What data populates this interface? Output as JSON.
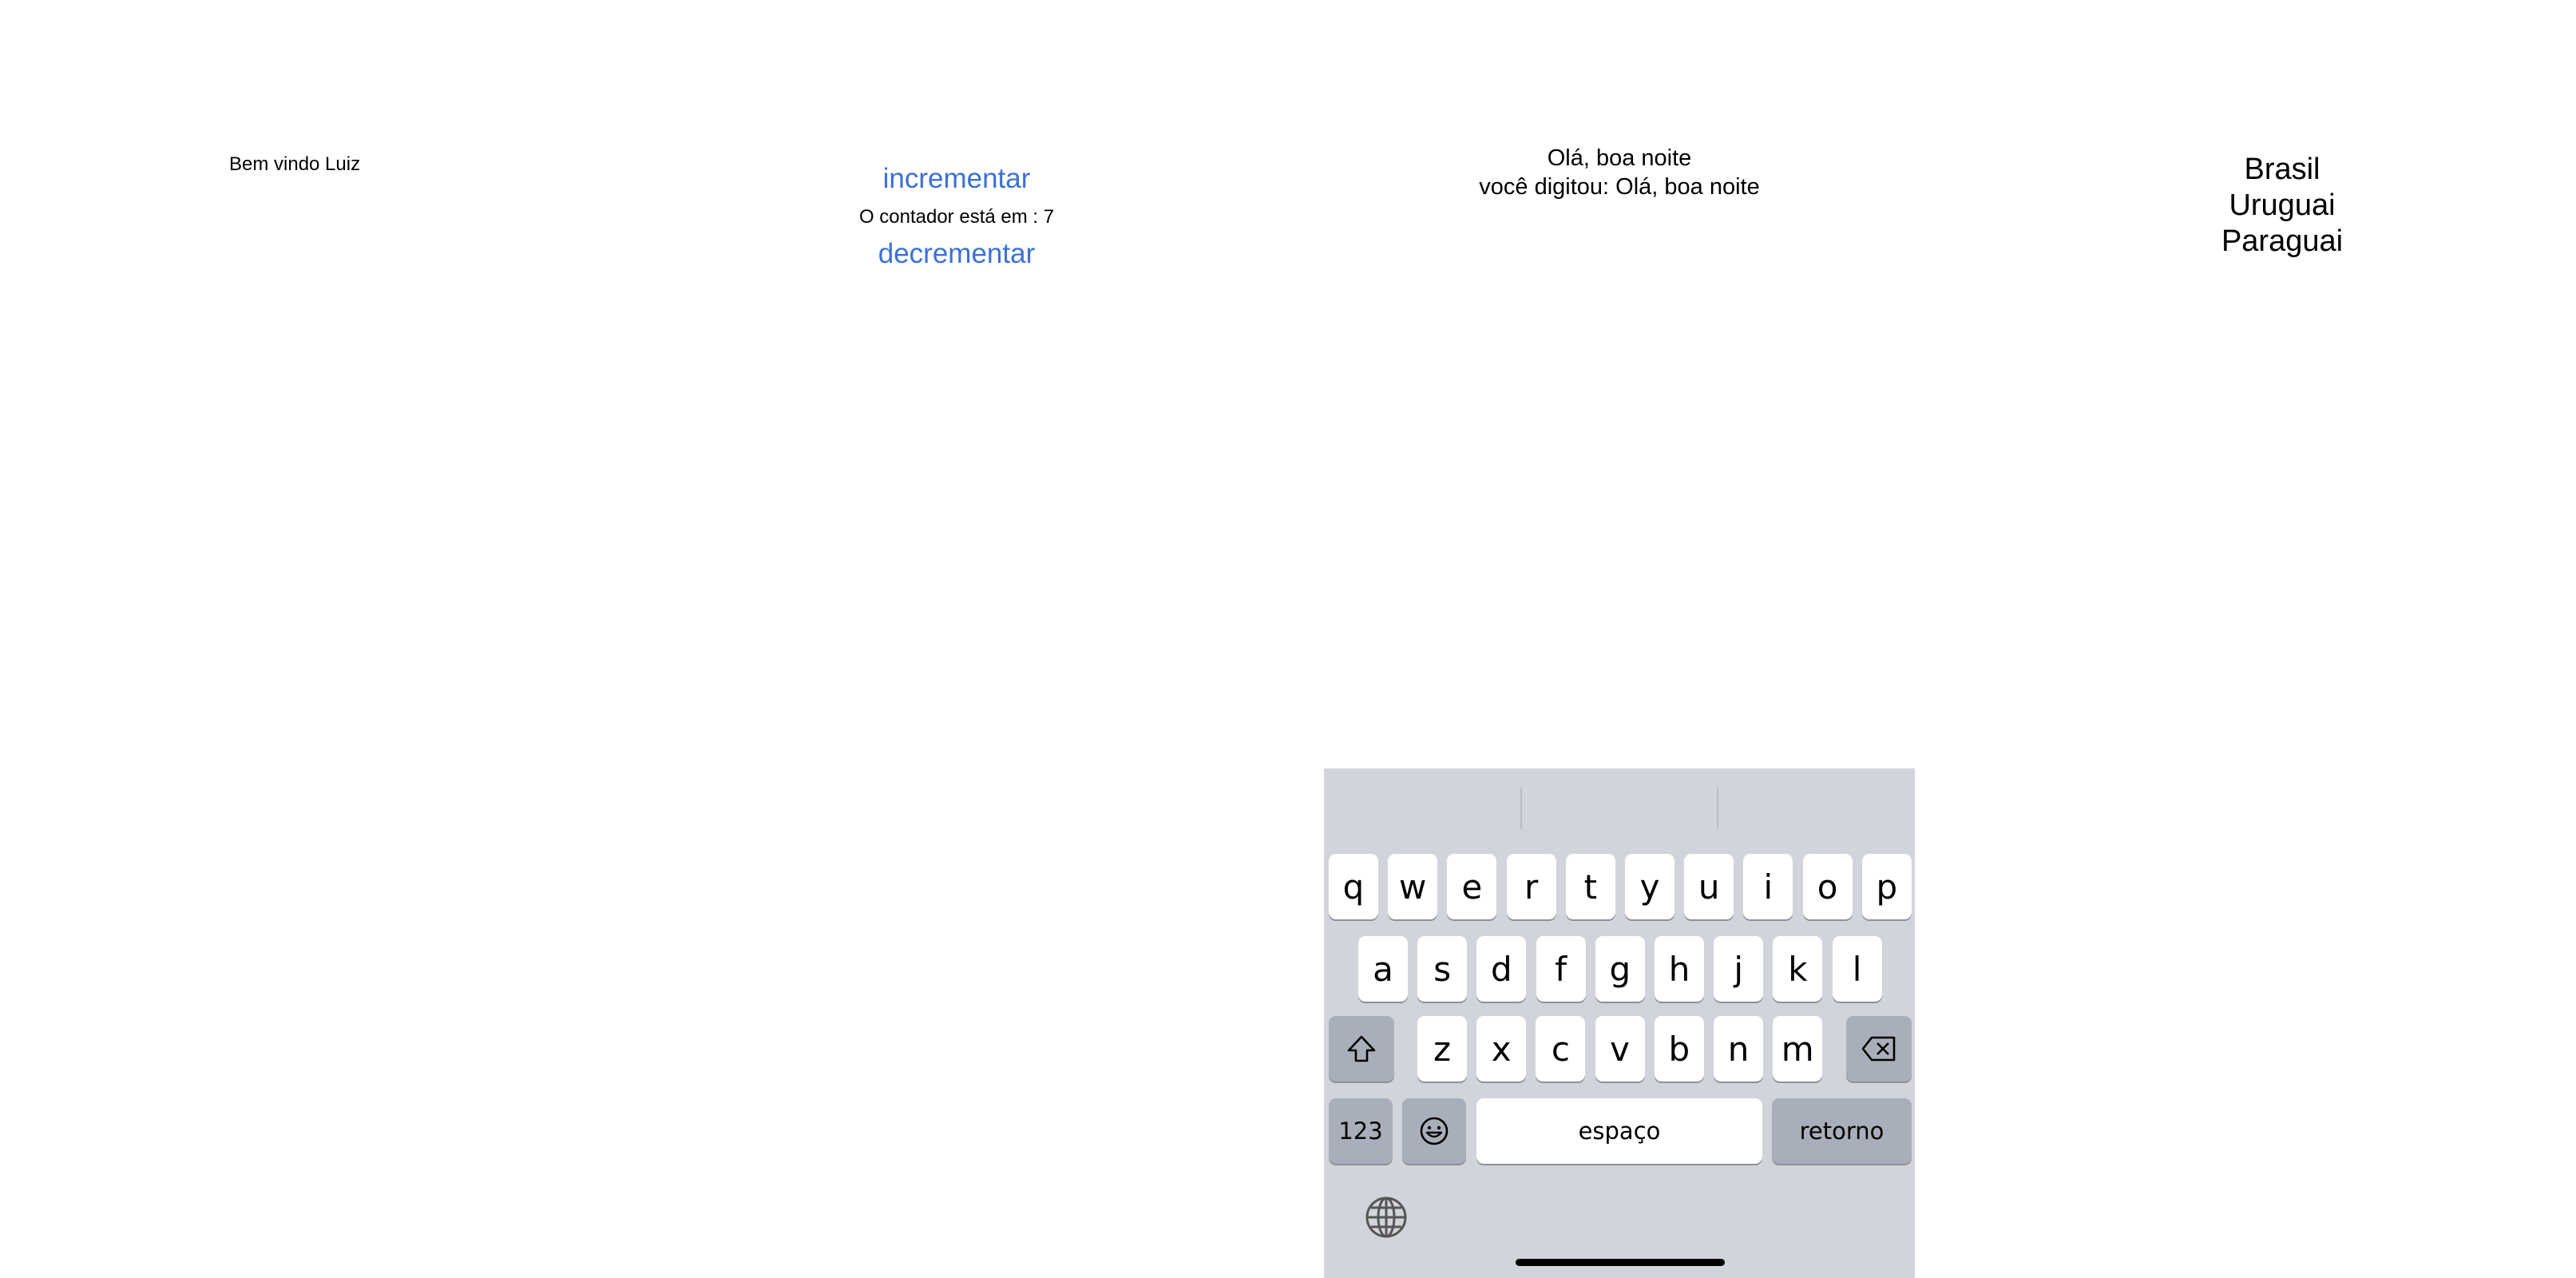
{
  "screen1": {
    "welcome": "Bem vindo Luiz"
  },
  "screen2": {
    "increment_label": "incrementar",
    "counter_text": "O contador está em : 7",
    "decrement_label": "decrementar",
    "link_color": "#3b71d6"
  },
  "screen3": {
    "typed_text": "Olá, boa noite",
    "echo_text": "você digitou: Olá, boa noite"
  },
  "keyboard": {
    "row1": [
      "q",
      "w",
      "e",
      "r",
      "t",
      "y",
      "u",
      "i",
      "o",
      "p"
    ],
    "row2": [
      "a",
      "s",
      "d",
      "f",
      "g",
      "h",
      "j",
      "k",
      "l"
    ],
    "row3": [
      "z",
      "x",
      "c",
      "v",
      "b",
      "n",
      "m"
    ],
    "numbers_label": "123",
    "space_label": "espaço",
    "return_label": "retorno",
    "icons": [
      "shift-icon",
      "backspace-icon",
      "emoji-icon",
      "globe-icon"
    ]
  },
  "screen4": {
    "countries": [
      "Brasil",
      "Uruguai",
      "Paraguai"
    ]
  }
}
